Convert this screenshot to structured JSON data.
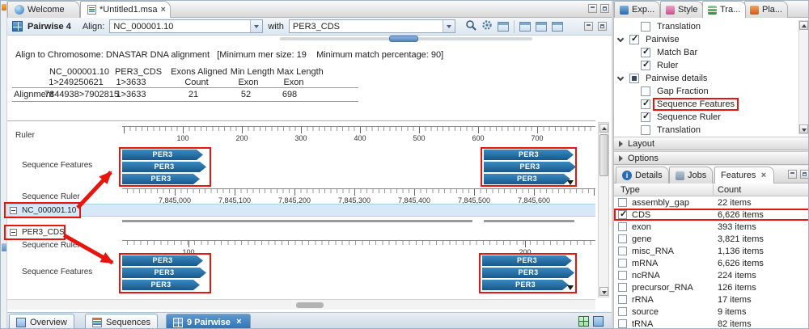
{
  "colors": {
    "accent_blue": "#2f6eb0",
    "feature_blue": "#1d6da3",
    "highlight_red": "#e8150f",
    "selected_row": "#d7e9f8"
  },
  "editor": {
    "tabs": [
      {
        "label": "Welcome"
      },
      {
        "label": "*Untitled1.msa"
      }
    ],
    "toolbar": {
      "view_label": "Pairwise 4",
      "align_label": "Align:",
      "align_value": "NC_000001.10",
      "with_label": "with",
      "with_value": "PER3_CDS"
    },
    "summary": {
      "heading": "Align to Chromosome: DNASTAR DNA alignment   [Minimum mer size: 19    Minimum match percentage: 90]",
      "columns": [
        {
          "line1": "NC_000001.10",
          "line2": "1>249250621"
        },
        {
          "line1": "PER3_CDS",
          "line2": "1>3633"
        },
        {
          "line1": "Exons Aligned",
          "line2": "Count"
        },
        {
          "line1": "Min Length",
          "line2": "Exon"
        },
        {
          "line1": "Max Length",
          "line2": "Exon"
        }
      ],
      "row": {
        "label": "Alignment",
        "values": [
          "7844938>7902815",
          "1>3633",
          "21",
          "52",
          "698"
        ]
      }
    },
    "alignment": {
      "row_labels": {
        "ruler": "Ruler",
        "features_top": "Sequence Features",
        "seq_ruler_top": "Sequence Ruler",
        "seq_ruler_bottom": "Sequence Ruler",
        "features_bottom": "Sequence Features"
      },
      "tracks": [
        {
          "label": "NC_000001.10"
        },
        {
          "label": "PER3_CDS"
        }
      ],
      "top_ruler_labels": [
        "100",
        "200",
        "300",
        "400",
        "500",
        "600",
        "700"
      ],
      "seq_ruler1_labels": [
        "7,845,000",
        "7,845,100",
        "7,845,200",
        "7,845,300",
        "7,845,400",
        "7,845,500",
        "7,845,600"
      ],
      "seq_ruler2_labels": [
        "100",
        "200"
      ],
      "feature_label": "PER3"
    },
    "bottom_tabs": [
      {
        "label": "Overview"
      },
      {
        "label": "Sequences"
      },
      {
        "label": "9 Pairwise",
        "active": true
      }
    ]
  },
  "right_panel": {
    "tabs": [
      {
        "label": "Exp..."
      },
      {
        "label": "Style"
      },
      {
        "label": "Tra...",
        "active": true
      },
      {
        "label": "Pla..."
      }
    ],
    "tracks_tree": [
      {
        "label": "Translation",
        "state": "unchecked",
        "depth": 1,
        "expanded": false,
        "highlighted": false
      },
      {
        "label": "Pairwise",
        "state": "checked",
        "depth": 0,
        "expanded": true,
        "highlighted": false
      },
      {
        "label": "Match Bar",
        "state": "checked",
        "depth": 1,
        "expanded": false,
        "highlighted": false
      },
      {
        "label": "Ruler",
        "state": "checked",
        "depth": 1,
        "expanded": false,
        "highlighted": false
      },
      {
        "label": "Pairwise details",
        "state": "partial",
        "depth": 0,
        "expanded": true,
        "highlighted": false
      },
      {
        "label": "Gap Fraction",
        "state": "unchecked",
        "depth": 1,
        "expanded": false,
        "highlighted": false
      },
      {
        "label": "Sequence Features",
        "state": "checked",
        "depth": 1,
        "expanded": false,
        "highlighted": true
      },
      {
        "label": "Sequence Ruler",
        "state": "checked",
        "depth": 1,
        "expanded": false,
        "highlighted": false
      },
      {
        "label": "Translation",
        "state": "unchecked",
        "depth": 1,
        "expanded": false,
        "highlighted": false
      }
    ],
    "sections": [
      {
        "label": "Layout"
      },
      {
        "label": "Options"
      }
    ],
    "features_panel": {
      "tabs": [
        {
          "label": "Details"
        },
        {
          "label": "Jobs"
        },
        {
          "label": "Features",
          "active": true
        }
      ],
      "columns": [
        "Type",
        "Count"
      ],
      "rows": [
        {
          "type": "assembly_gap",
          "count": "22 items",
          "checked": false,
          "highlighted": false
        },
        {
          "type": "CDS",
          "count": "6,626 items",
          "checked": true,
          "highlighted": true
        },
        {
          "type": "exon",
          "count": "393 items",
          "checked": false,
          "highlighted": false
        },
        {
          "type": "gene",
          "count": "3,821 items",
          "checked": false,
          "highlighted": false
        },
        {
          "type": "misc_RNA",
          "count": "1,136 items",
          "checked": false,
          "highlighted": false
        },
        {
          "type": "mRNA",
          "count": "6,626 items",
          "checked": false,
          "highlighted": false
        },
        {
          "type": "ncRNA",
          "count": "224 items",
          "checked": false,
          "highlighted": false
        },
        {
          "type": "precursor_RNA",
          "count": "126 items",
          "checked": false,
          "highlighted": false
        },
        {
          "type": "rRNA",
          "count": "17 items",
          "checked": false,
          "highlighted": false
        },
        {
          "type": "source",
          "count": "9 items",
          "checked": false,
          "highlighted": false
        },
        {
          "type": "tRNA",
          "count": "82 items",
          "checked": false,
          "highlighted": false
        }
      ]
    }
  }
}
